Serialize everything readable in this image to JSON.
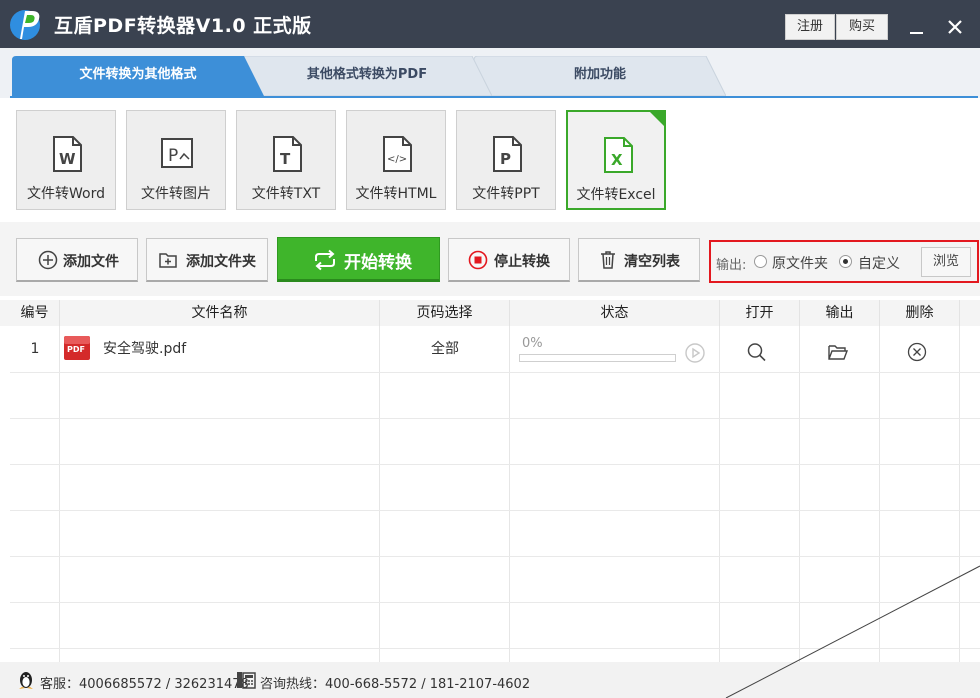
{
  "app": {
    "title": "互盾PDF转换器V1.0 正式版"
  },
  "titlebar": {
    "register_label": "注册",
    "buy_label": "购买"
  },
  "tabs": [
    {
      "label": "文件转换为其他格式",
      "active": true
    },
    {
      "label": "其他格式转换为PDF",
      "active": false
    },
    {
      "label": "附加功能",
      "active": false
    }
  ],
  "functions": [
    {
      "label": "文件转Word",
      "icon": "word-file-icon"
    },
    {
      "label": "文件转图片",
      "icon": "image-file-icon"
    },
    {
      "label": "文件转TXT",
      "icon": "txt-file-icon"
    },
    {
      "label": "文件转HTML",
      "icon": "html-file-icon"
    },
    {
      "label": "文件转PPT",
      "icon": "ppt-file-icon"
    },
    {
      "label": "文件转Excel",
      "icon": "excel-file-icon",
      "selected": true
    }
  ],
  "toolbar": {
    "add_file": "添加文件",
    "add_folder": "添加文件夹",
    "start": "开始转换",
    "stop": "停止转换",
    "clear": "清空列表"
  },
  "output": {
    "label": "输出:",
    "option_original": "原文件夹",
    "option_custom": "自定义",
    "selected": "自定义",
    "browse": "浏览"
  },
  "table": {
    "headers": [
      "编号",
      "文件名称",
      "页码选择",
      "状态",
      "打开",
      "输出",
      "删除"
    ],
    "rows": [
      {
        "index": "1",
        "filename": "安全驾驶.pdf",
        "pages": "全部",
        "progress_text": "0%",
        "progress": 0
      }
    ]
  },
  "statusbar": {
    "service": "客服：4006685572 / 326231478",
    "hotline": "咨询热线：400-668-5572 / 181-2107-4602"
  },
  "colors": {
    "titlebar": "#3a4250",
    "accent_blue": "#3d8fd8",
    "start_green": "#3fb52b",
    "highlight_red": "#e3181f"
  }
}
